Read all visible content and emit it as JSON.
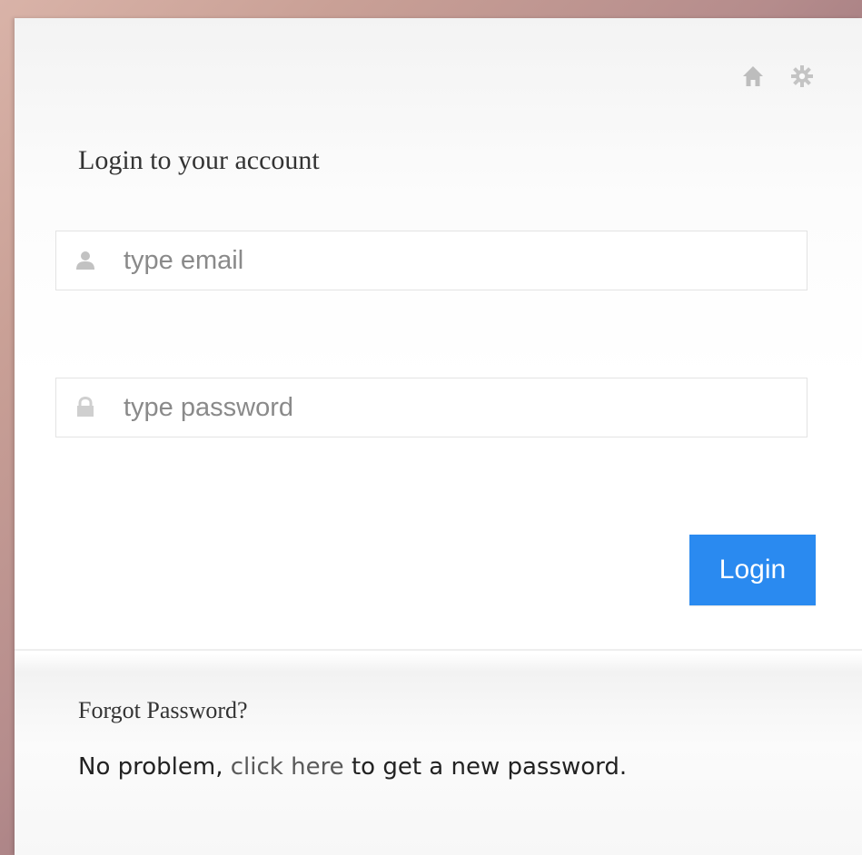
{
  "header": {
    "home_icon": "home-icon",
    "settings_icon": "gear-icon"
  },
  "login": {
    "title": "Login to your account",
    "email": {
      "icon": "user-icon",
      "placeholder": "type email",
      "value": ""
    },
    "password": {
      "icon": "lock-icon",
      "placeholder": "type password",
      "value": ""
    },
    "button_label": "Login"
  },
  "forgot": {
    "title": "Forgot Password?",
    "text_before": "No problem, ",
    "link_text": "click here",
    "text_after": " to get a new password."
  },
  "colors": {
    "button_bg": "#2a8af0",
    "button_text": "#ffffff",
    "icon_gray": "#b5b5b5",
    "placeholder": "#8a8a8a"
  }
}
